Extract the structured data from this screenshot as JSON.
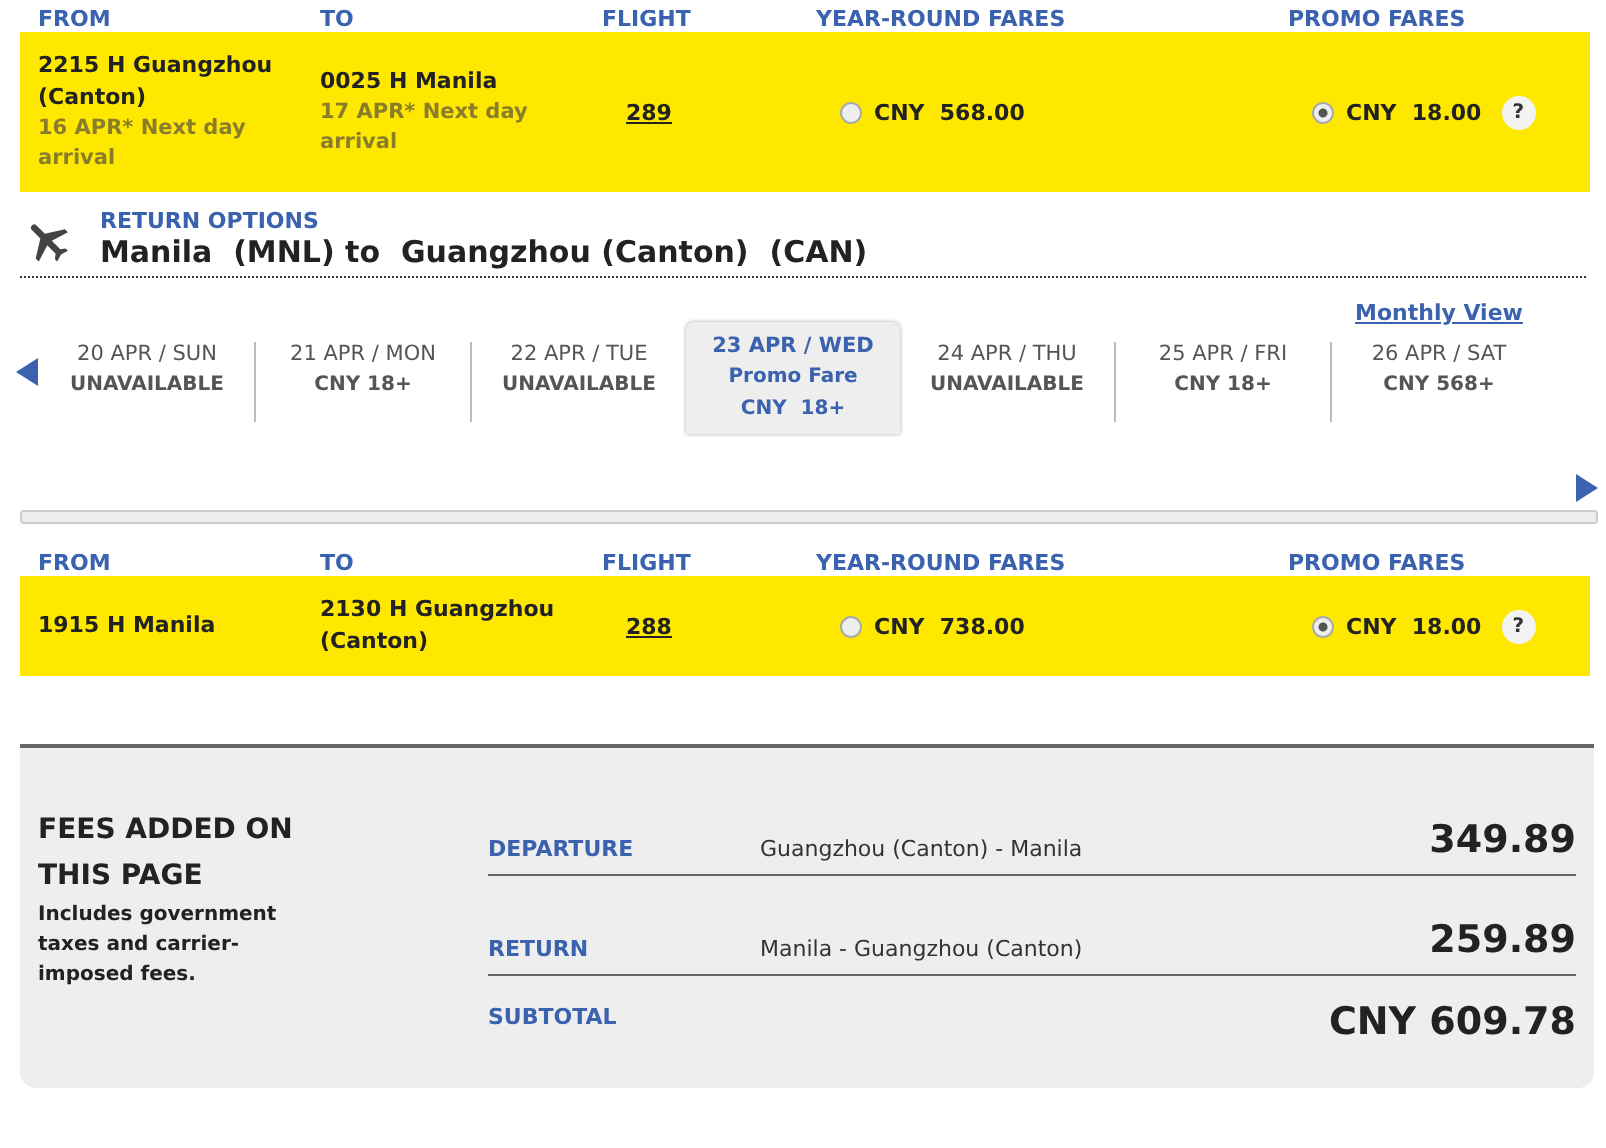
{
  "departure": {
    "columns": [
      "FROM",
      "TO",
      "FLIGHT",
      "YEAR-ROUND FARES",
      "PROMO FARES"
    ],
    "rows": [
      {
        "from": "2215 H  Guangzhou (Canton)",
        "from_note": "16 APR*   Next day arrival",
        "to": "0025 H  Manila",
        "to_note": "17 APR*   Next day arrival",
        "flight": "289",
        "fares": [
          {
            "price": "CNY  568.00",
            "selected": false
          },
          {
            "price": "CNY  18.00",
            "selected": true,
            "help": "?"
          }
        ]
      }
    ]
  },
  "return_options": {
    "label": "RETURN OPTIONS",
    "route": "Manila  (MNL) to  Guangzhou (Canton)  (CAN)",
    "monthly_view": "Monthly View",
    "dates": [
      {
        "day": "20 APR / SUN",
        "fare": "UNAVAILABLE",
        "selected": false
      },
      {
        "day": "21 APR / MON",
        "fare": "CNY 18+",
        "selected": false
      },
      {
        "day": "22 APR / TUE",
        "fare": "UNAVAILABLE",
        "selected": false
      },
      {
        "day": "23 APR / WED",
        "note": "Promo Fare",
        "fare": "CNY  18+",
        "selected": true
      },
      {
        "day": "24 APR / THU",
        "fare": "UNAVAILABLE",
        "selected": false
      },
      {
        "day": "25 APR / FRI",
        "fare": "CNY 18+",
        "selected": false
      },
      {
        "day": "26 APR / SAT",
        "fare": "CNY 568+",
        "selected": false
      }
    ]
  },
  "return": {
    "columns": [
      "FROM",
      "TO",
      "FLIGHT",
      "YEAR-ROUND FARES",
      "PROMO FARES"
    ],
    "rows": [
      {
        "from": "1915 H  Manila",
        "to": "2130 H  Guangzhou (Canton)",
        "flight": "288",
        "fares": [
          {
            "price": "CNY  738.00",
            "selected": false
          },
          {
            "price": "CNY  18.00",
            "selected": true,
            "help": "?"
          }
        ]
      }
    ]
  },
  "fees": {
    "title": "FEES ADDED ON THIS PAGE",
    "note": "Includes government taxes and carrier-imposed fees.",
    "items": [
      {
        "label": "DEPARTURE",
        "route": "Guangzhou (Canton) - Manila",
        "amount": "349.89"
      },
      {
        "label": "RETURN",
        "route": "Manila - Guangzhou (Canton)",
        "amount": "259.89"
      }
    ],
    "subtotal_label": "SUBTOTAL",
    "subtotal": "CNY 609.78"
  }
}
